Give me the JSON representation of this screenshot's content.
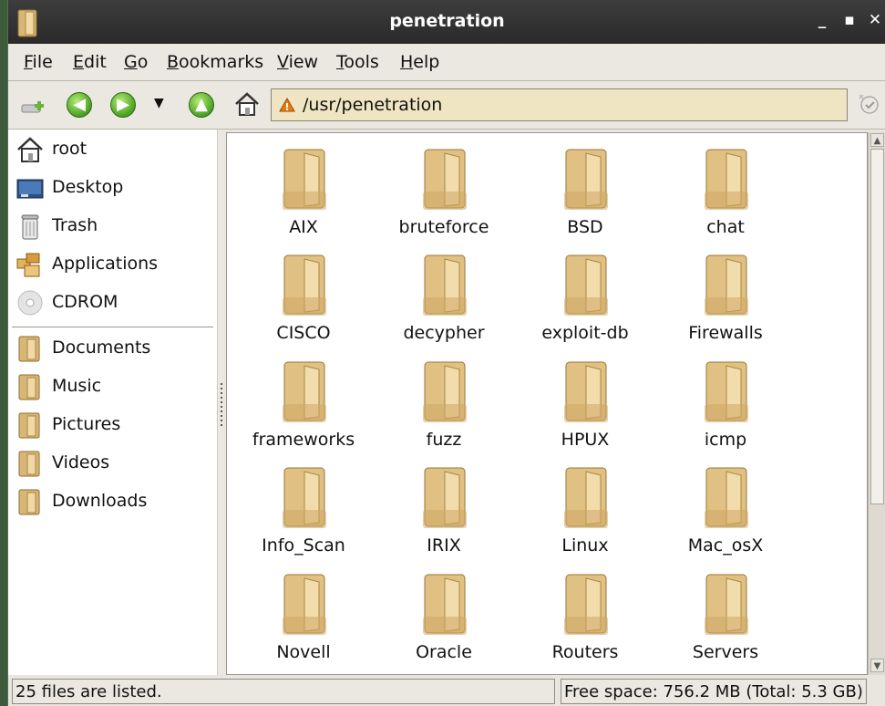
{
  "window": {
    "title": "penetration",
    "minimize_glyph": "_",
    "maximize_glyph": "▪",
    "close_glyph": "✕"
  },
  "menu": [
    {
      "label": "File",
      "mnemonic": "F",
      "rest": "ile"
    },
    {
      "label": "Edit",
      "mnemonic": "E",
      "rest": "dit"
    },
    {
      "label": "Go",
      "mnemonic": "G",
      "rest": "o"
    },
    {
      "label": "Bookmarks",
      "mnemonic": "B",
      "rest": "ookmarks"
    },
    {
      "label": "View",
      "mnemonic": "V",
      "rest": "iew"
    },
    {
      "label": "Tools",
      "mnemonic": "T",
      "rest": "ools"
    },
    {
      "label": "Help",
      "mnemonic": "H",
      "rest": "elp"
    }
  ],
  "toolbar": {
    "location": "/usr/penetration",
    "back_glyph": "◀",
    "forward_glyph": "▶",
    "dropdown_glyph": "▼",
    "up_glyph": "▲"
  },
  "sidebar": {
    "places": [
      {
        "label": "root",
        "icon": "home-icon"
      },
      {
        "label": "Desktop",
        "icon": "desktop-icon"
      },
      {
        "label": "Trash",
        "icon": "trash-icon"
      },
      {
        "label": "Applications",
        "icon": "applications-icon"
      },
      {
        "label": "CDROM",
        "icon": "cdrom-icon"
      }
    ],
    "bookmarks": [
      {
        "label": "Documents",
        "icon": "folder-icon"
      },
      {
        "label": "Music",
        "icon": "folder-icon"
      },
      {
        "label": "Pictures",
        "icon": "folder-icon"
      },
      {
        "label": "Videos",
        "icon": "folder-icon"
      },
      {
        "label": "Downloads",
        "icon": "folder-icon"
      }
    ]
  },
  "files": [
    "AIX",
    "bruteforce",
    "BSD",
    "chat",
    "CISCO",
    "decypher",
    "exploit-db",
    "Firewalls",
    "frameworks",
    "fuzz",
    "HPUX",
    "icmp",
    "Info_Scan",
    "IRIX",
    "Linux",
    "Mac_osX",
    "Novell",
    "Oracle",
    "Routers",
    "Servers"
  ],
  "status": {
    "left": "25 files are listed.",
    "right": "Free space: 756.2 MB (Total: 5.3 GB)"
  },
  "colors": {
    "folder": "#e7c98c",
    "location_bg": "#efe5c2",
    "nav_green": "#4fa626"
  }
}
